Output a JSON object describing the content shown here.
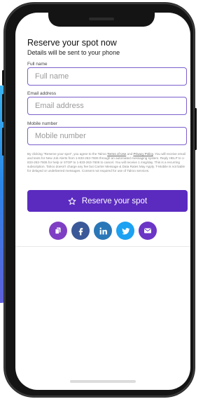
{
  "form": {
    "title": "Reserve your spot now",
    "subtitle": "Details will be sent to your phone",
    "fields": [
      {
        "label": "Full name",
        "placeholder": "Full name",
        "value": ""
      },
      {
        "label": "Email address",
        "placeholder": "Email address",
        "value": ""
      },
      {
        "label": "Mobile number",
        "placeholder": "Mobile number",
        "value": ""
      }
    ],
    "disclaimer": {
      "before_terms": "By clicking \"Reserve your spot\", you agree to the Talroo ",
      "terms_link": "Terms of Use",
      "and": " and ",
      "privacy_link": "Privacy Policy",
      "after_privacy": ". You will receive email and texts for New Job Alerts from 1-833-263-7606 through an automated messaging system. Reply HELP to 1-833-263-7606 for help or STOP to 1-833-263-7606 to cancel. You will receive 1 msg/day. This is a recurring subscription. Talroo doesn't charge any fee but Carrier Message & Data Rates May Apply. T-Mobile is not liable for delayed or undelivered messages. Consent not required for use of Talroo services."
    },
    "submit_label": "Reserve your spot"
  },
  "share": {
    "icons": [
      {
        "name": "copy-icon",
        "color": "#7f3fc4"
      },
      {
        "name": "facebook-icon",
        "color": "#3b5998"
      },
      {
        "name": "linkedin-icon",
        "color": "#2a77b8"
      },
      {
        "name": "twitter-icon",
        "color": "#1da1f2"
      },
      {
        "name": "email-icon",
        "color": "#6b35c6"
      }
    ]
  },
  "colors": {
    "accent": "#5b2bc0",
    "field_border": "#7b5fcc"
  }
}
